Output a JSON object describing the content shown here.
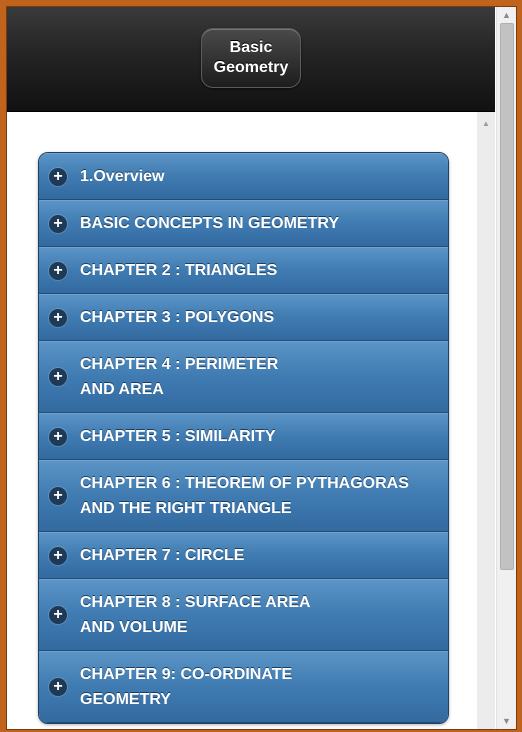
{
  "header": {
    "title_line1": "Basic",
    "title_line2": "Geometry"
  },
  "menu": {
    "expand_icon": "plus-circle-icon",
    "items": [
      {
        "label": "1.Overview"
      },
      {
        "label": "BASIC CONCEPTS IN GEOMETRY"
      },
      {
        "label": "CHAPTER 2 : TRIANGLES"
      },
      {
        "label": "CHAPTER 3 : POLYGONS"
      },
      {
        "label": "CHAPTER 4 : PERIMETER\nAND AREA"
      },
      {
        "label": "CHAPTER 5 : SIMILARITY"
      },
      {
        "label": "CHAPTER 6 : THEOREM OF PYTHAGORAS\nAND THE RIGHT TRIANGLE"
      },
      {
        "label": "CHAPTER 7 : CIRCLE"
      },
      {
        "label": "CHAPTER 8 : SURFACE AREA\nAND VOLUME"
      },
      {
        "label": "CHAPTER 9: CO-ORDINATE\nGEOMETRY"
      }
    ]
  },
  "colors": {
    "frame": "#c0631c",
    "header": "#1b1b1b",
    "menu_item": "#3f7bb1"
  }
}
